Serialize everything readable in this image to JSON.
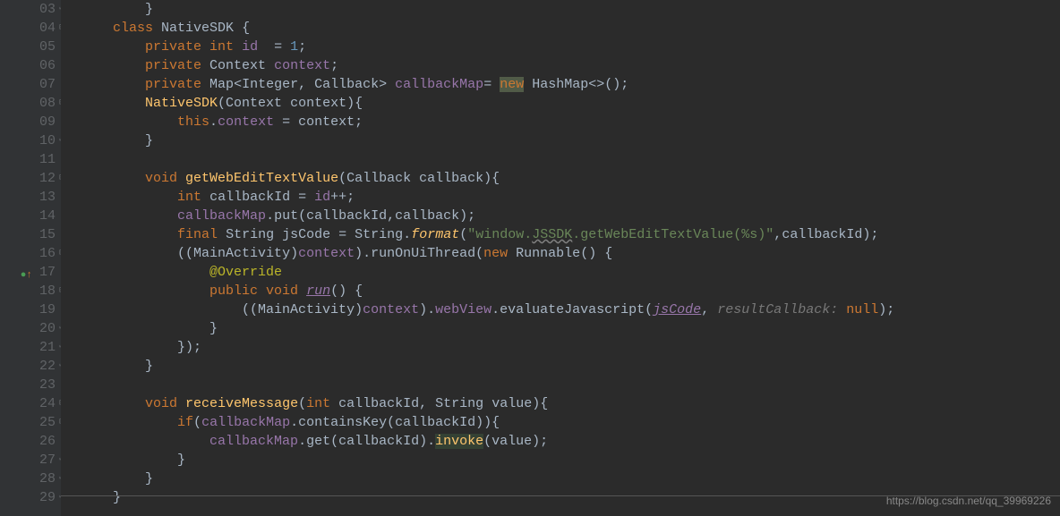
{
  "lineStart": 3,
  "lineEnd": 29,
  "markerLine": 17,
  "watermark": "https://blog.csdn.net/qq_39969226",
  "tokens": {
    "l3": [
      [
        "",
        "        "
      ],
      [
        "punct",
        "}"
      ]
    ],
    "l4": [
      [
        "",
        "    "
      ],
      [
        "kw",
        "class"
      ],
      [
        "",
        " "
      ],
      [
        "type",
        "NativeSDK"
      ],
      [
        "",
        " "
      ],
      [
        "punct",
        "{"
      ]
    ],
    "l5": [
      [
        "",
        "        "
      ],
      [
        "kw",
        "private int"
      ],
      [
        "",
        " "
      ],
      [
        "field",
        "id"
      ],
      [
        "",
        "  "
      ],
      [
        "punct",
        "="
      ],
      [
        "",
        " "
      ],
      [
        "num",
        "1"
      ],
      [
        "punct",
        ";"
      ]
    ],
    "l6": [
      [
        "",
        "        "
      ],
      [
        "kw",
        "private"
      ],
      [
        "",
        " "
      ],
      [
        "type",
        "Context"
      ],
      [
        "",
        " "
      ],
      [
        "field",
        "context"
      ],
      [
        "punct",
        ";"
      ]
    ],
    "l7": [
      [
        "",
        "        "
      ],
      [
        "kw",
        "private"
      ],
      [
        "",
        " "
      ],
      [
        "type",
        "Map"
      ],
      [
        "punct",
        "<"
      ],
      [
        "type",
        "Integer"
      ],
      [
        "punct",
        ","
      ],
      [
        "",
        " "
      ],
      [
        "type",
        "Callback"
      ],
      [
        "punct",
        ">"
      ],
      [
        "",
        " "
      ],
      [
        "field",
        "callbackMap"
      ],
      [
        "punct",
        "="
      ],
      [
        "",
        " "
      ],
      [
        "hlbg",
        "new"
      ],
      [
        "",
        " "
      ],
      [
        "type",
        "HashMap"
      ],
      [
        "punct",
        "<>();"
      ]
    ],
    "l8": [
      [
        "",
        "        "
      ],
      [
        "fn",
        "NativeSDK"
      ],
      [
        "punct",
        "("
      ],
      [
        "type",
        "Context"
      ],
      [
        "",
        " "
      ],
      [
        "param",
        "context"
      ],
      [
        "punct",
        "){"
      ]
    ],
    "l9": [
      [
        "",
        "            "
      ],
      [
        "kw",
        "this"
      ],
      [
        "punct",
        "."
      ],
      [
        "field",
        "context"
      ],
      [
        "",
        " "
      ],
      [
        "punct",
        "="
      ],
      [
        "",
        " "
      ],
      [
        "param",
        "context"
      ],
      [
        "punct",
        ";"
      ]
    ],
    "l10": [
      [
        "",
        "        "
      ],
      [
        "punct",
        "}"
      ]
    ],
    "l11": [],
    "l12": [
      [
        "",
        "        "
      ],
      [
        "kw",
        "void"
      ],
      [
        "",
        " "
      ],
      [
        "fn",
        "getWebEditTextValue"
      ],
      [
        "punct",
        "("
      ],
      [
        "type",
        "Callback"
      ],
      [
        "",
        " "
      ],
      [
        "param",
        "callback"
      ],
      [
        "punct",
        "){"
      ]
    ],
    "l13": [
      [
        "",
        "            "
      ],
      [
        "kw",
        "int"
      ],
      [
        "",
        " "
      ],
      [
        "param",
        "callbackId"
      ],
      [
        "",
        " "
      ],
      [
        "punct",
        "="
      ],
      [
        "",
        " "
      ],
      [
        "field",
        "id"
      ],
      [
        "punct",
        "++;"
      ]
    ],
    "l14": [
      [
        "",
        "            "
      ],
      [
        "field",
        "callbackMap"
      ],
      [
        "punct",
        ".put("
      ],
      [
        "param",
        "callbackId"
      ],
      [
        "punct",
        ","
      ],
      [
        "param",
        "callback"
      ],
      [
        "punct",
        ");"
      ]
    ],
    "l15": [
      [
        "",
        "            "
      ],
      [
        "kw",
        "final"
      ],
      [
        "",
        " "
      ],
      [
        "type",
        "String"
      ],
      [
        "",
        " "
      ],
      [
        "param",
        "jsCode"
      ],
      [
        "",
        " "
      ],
      [
        "punct",
        "="
      ],
      [
        "",
        " "
      ],
      [
        "type",
        "String"
      ],
      [
        "punct",
        "."
      ],
      [
        "fni",
        "format"
      ],
      [
        "punct",
        "("
      ],
      [
        "str",
        "\"window."
      ],
      [
        "strwarn",
        "JSSDK"
      ],
      [
        "str",
        ".getWebEditTextValue(%s)\""
      ],
      [
        "punct",
        ","
      ],
      [
        "param",
        "callbackId"
      ],
      [
        "punct",
        ");"
      ]
    ],
    "l16": [
      [
        "",
        "            "
      ],
      [
        "punct",
        "(("
      ],
      [
        "type",
        "MainActivity"
      ],
      [
        "punct",
        ")"
      ],
      [
        "field",
        "context"
      ],
      [
        "punct",
        ").runOnUiThread("
      ],
      [
        "kw",
        "new"
      ],
      [
        "",
        " "
      ],
      [
        "type",
        "Runnable"
      ],
      [
        "punct",
        "() {"
      ]
    ],
    "l17": [
      [
        "",
        "                "
      ],
      [
        "ann",
        "@Override"
      ]
    ],
    "l18": [
      [
        "",
        "                "
      ],
      [
        "kw",
        "public void"
      ],
      [
        "",
        " "
      ],
      [
        "under",
        "run"
      ],
      [
        "punct",
        "() {"
      ]
    ],
    "l19": [
      [
        "",
        "                    "
      ],
      [
        "punct",
        "(("
      ],
      [
        "type",
        "MainActivity"
      ],
      [
        "punct",
        ")"
      ],
      [
        "field",
        "context"
      ],
      [
        "punct",
        ")."
      ],
      [
        "field",
        "webView"
      ],
      [
        "punct",
        ".evaluateJavascript("
      ],
      [
        "under",
        "jsCode"
      ],
      [
        "punct",
        ","
      ],
      [
        "",
        " "
      ],
      [
        "hint",
        "resultCallback:"
      ],
      [
        "",
        " "
      ],
      [
        "kw",
        "null"
      ],
      [
        "punct",
        ");"
      ]
    ],
    "l20": [
      [
        "",
        "                "
      ],
      [
        "punct",
        "}"
      ]
    ],
    "l21": [
      [
        "",
        "            "
      ],
      [
        "punct",
        "});"
      ]
    ],
    "l22": [
      [
        "",
        "        "
      ],
      [
        "punct",
        "}"
      ]
    ],
    "l23": [],
    "l24": [
      [
        "",
        "        "
      ],
      [
        "kw",
        "void"
      ],
      [
        "",
        " "
      ],
      [
        "fn",
        "receiveMessage"
      ],
      [
        "punct",
        "("
      ],
      [
        "kw",
        "int"
      ],
      [
        "",
        " "
      ],
      [
        "param",
        "callbackId"
      ],
      [
        "punct",
        ","
      ],
      [
        "",
        " "
      ],
      [
        "type",
        "String"
      ],
      [
        "",
        " "
      ],
      [
        "param",
        "value"
      ],
      [
        "punct",
        "){"
      ]
    ],
    "l25": [
      [
        "",
        "            "
      ],
      [
        "kw",
        "if"
      ],
      [
        "punct",
        "("
      ],
      [
        "field",
        "callbackMap"
      ],
      [
        "punct",
        ".containsKey("
      ],
      [
        "param",
        "callbackId"
      ],
      [
        "punct",
        ")){"
      ]
    ],
    "l26": [
      [
        "",
        "                "
      ],
      [
        "field",
        "callbackMap"
      ],
      [
        "punct",
        ".get("
      ],
      [
        "param",
        "callbackId"
      ],
      [
        "punct",
        ")."
      ],
      [
        "hlbg2",
        "invoke"
      ],
      [
        "punct",
        "("
      ],
      [
        "param",
        "value"
      ],
      [
        "punct",
        ");"
      ]
    ],
    "l27": [
      [
        "",
        "            "
      ],
      [
        "punct",
        "}"
      ]
    ],
    "l28": [
      [
        "",
        "        "
      ],
      [
        "punct",
        "}"
      ]
    ],
    "l29": [
      [
        "",
        "    "
      ],
      [
        "punct",
        "}"
      ]
    ]
  },
  "foldMarks": {
    "3": "end",
    "4": "start",
    "8": "start",
    "10": "end",
    "12": "start",
    "16": "start",
    "17": "mid",
    "18": "start",
    "20": "end",
    "21": "end",
    "22": "end",
    "24": "start",
    "25": "start",
    "27": "end",
    "28": "end",
    "29": "end"
  }
}
